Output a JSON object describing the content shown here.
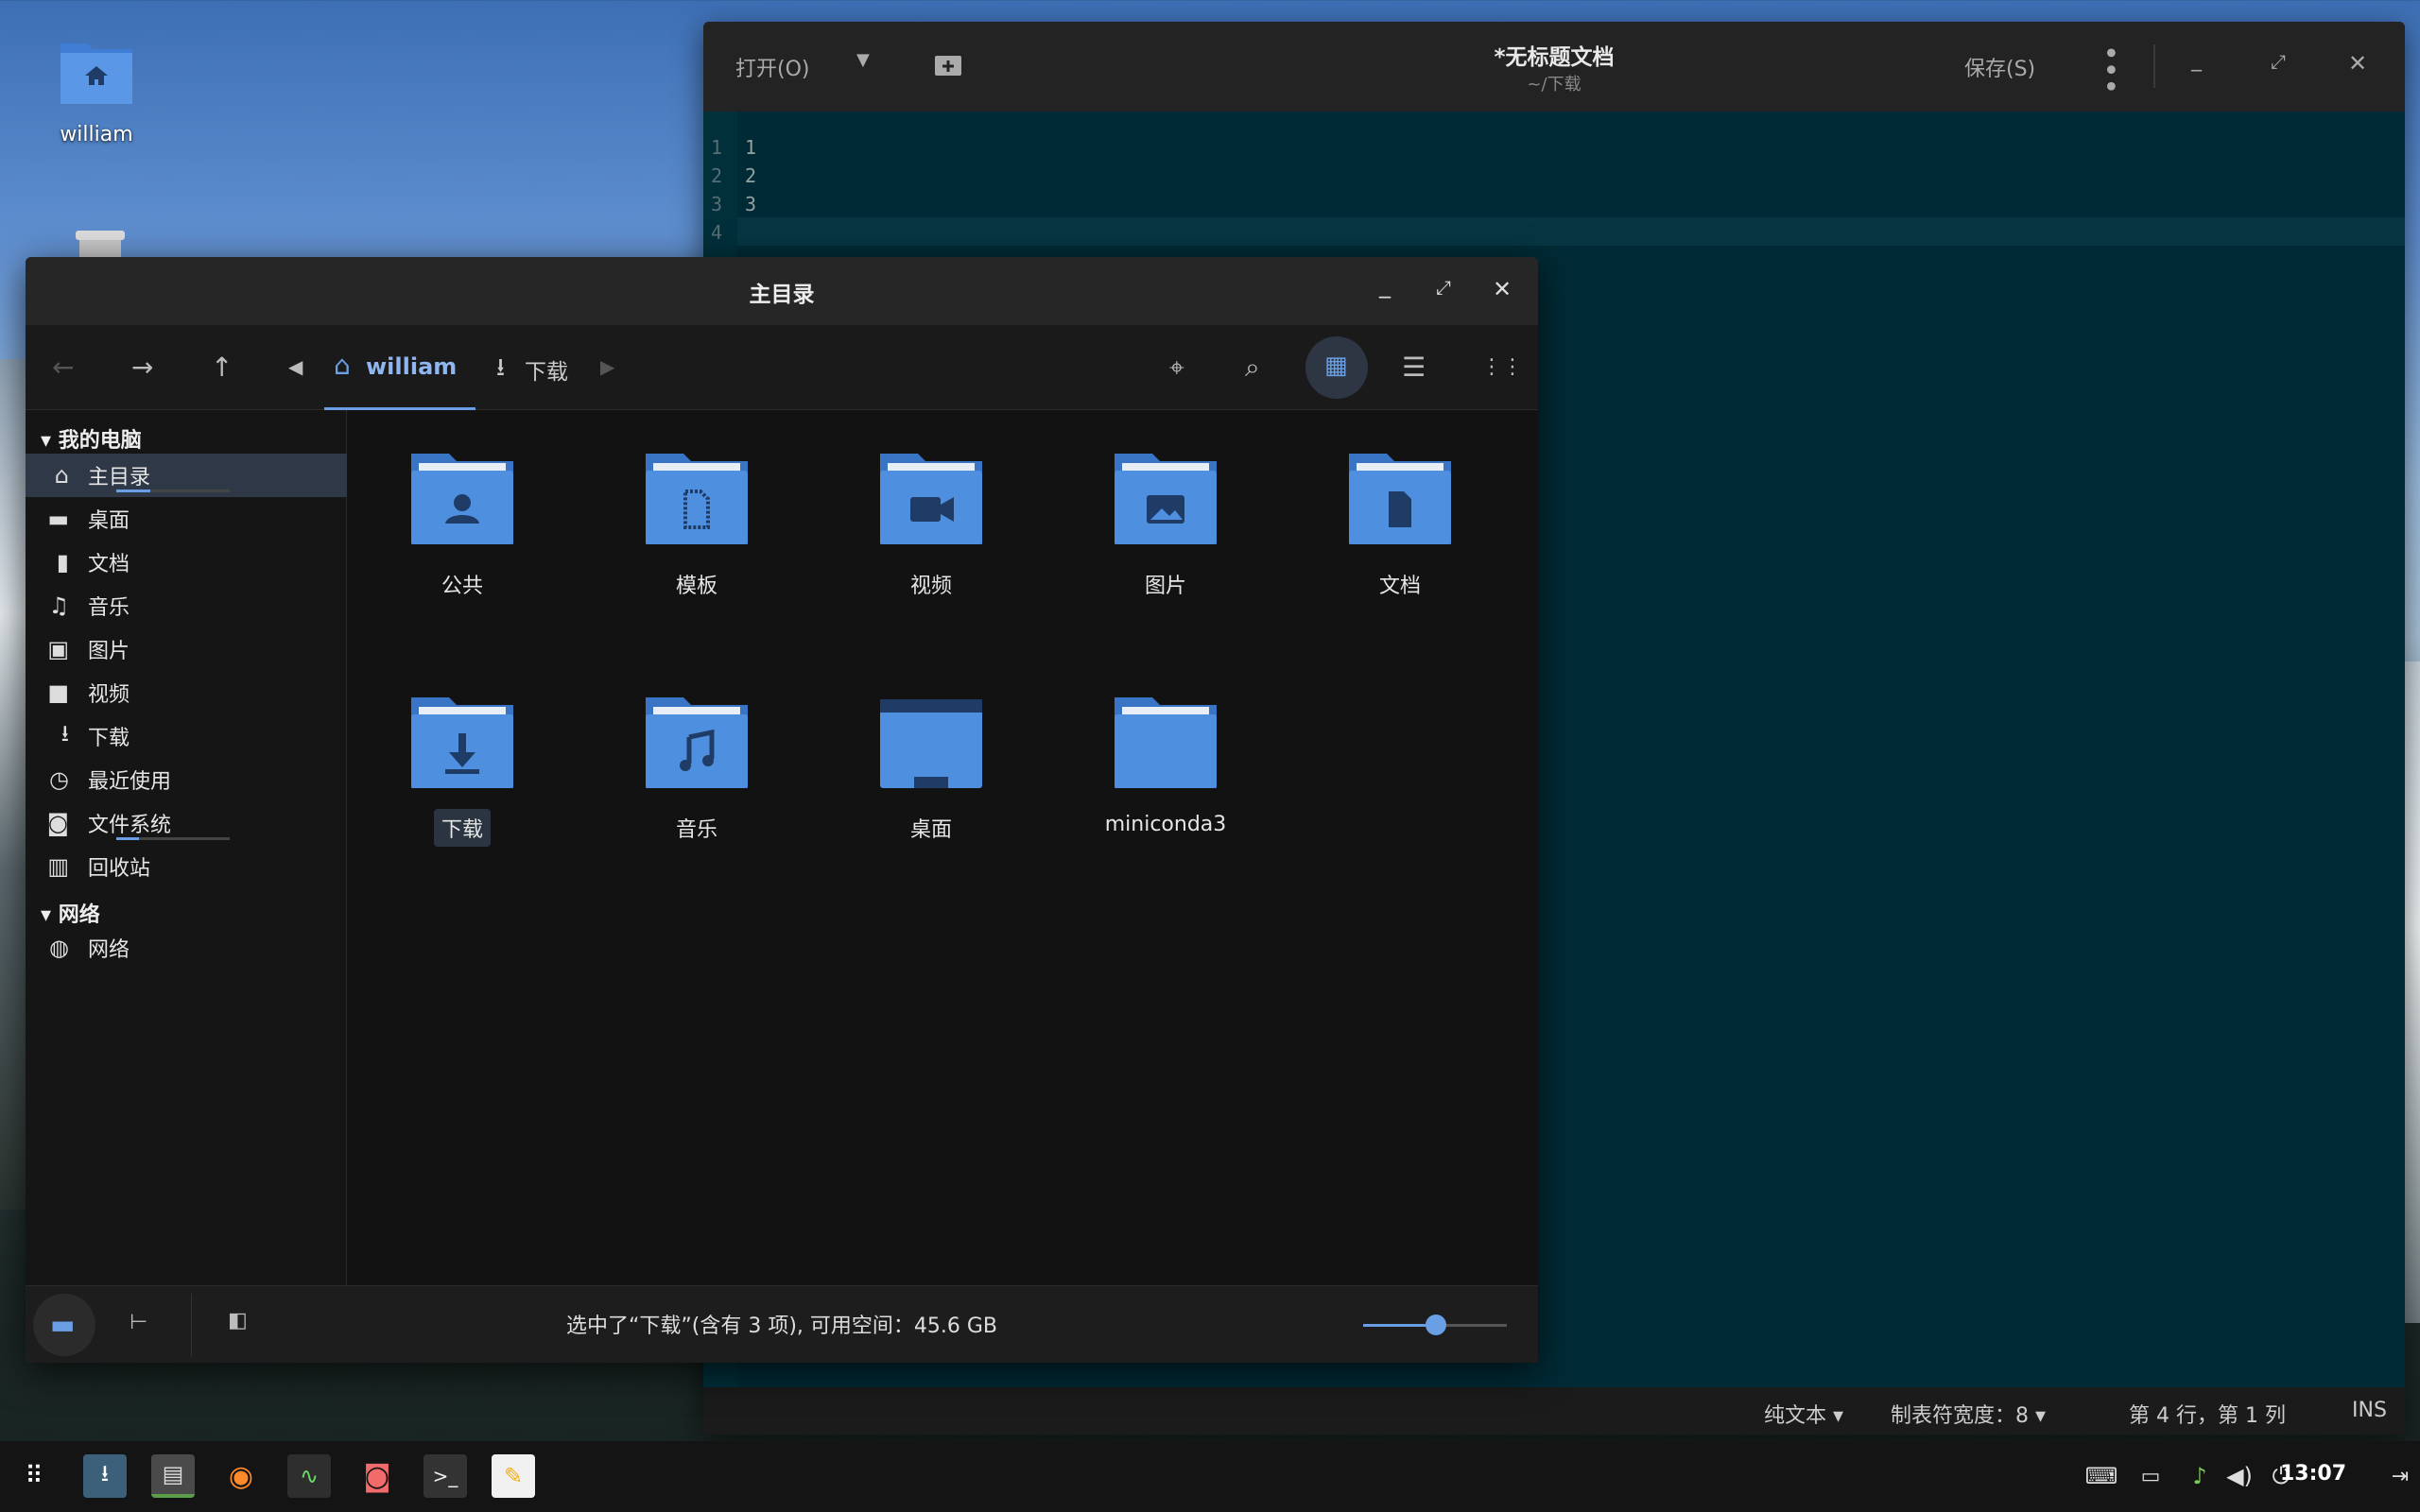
{
  "desktop": {
    "icons": [
      {
        "label": "william",
        "icon": "home-folder-icon"
      },
      {
        "label": "",
        "icon": "trash-icon"
      }
    ]
  },
  "editor": {
    "open_label": "打开(O)",
    "title": "*无标题文档",
    "subtitle": "~/下载",
    "save_label": "保存(S)",
    "lines": [
      "1",
      "2",
      "3",
      ""
    ],
    "line_numbers": [
      "1",
      "2",
      "3",
      "4"
    ],
    "status": {
      "syntax": "纯文本",
      "tab_width": "制表符宽度：8",
      "position": "第 4 行，第 1 列",
      "mode": "INS"
    }
  },
  "filemanager": {
    "title": "主目录",
    "breadcrumb": [
      {
        "label": "william",
        "icon": "home-icon"
      },
      {
        "label": "下载",
        "icon": "download-icon"
      }
    ],
    "sidebar": {
      "sections": [
        {
          "header": "我的电脑",
          "items": [
            {
              "label": "主目录",
              "icon": "home-icon",
              "selected": true
            },
            {
              "label": "桌面",
              "icon": "desktop-icon"
            },
            {
              "label": "文档",
              "icon": "document-icon"
            },
            {
              "label": "音乐",
              "icon": "music-icon"
            },
            {
              "label": "图片",
              "icon": "image-icon"
            },
            {
              "label": "视频",
              "icon": "video-icon"
            },
            {
              "label": "下载",
              "icon": "download-icon"
            },
            {
              "label": "最近使用",
              "icon": "clock-icon"
            },
            {
              "label": "文件系统",
              "icon": "drive-icon"
            },
            {
              "label": "回收站",
              "icon": "trash-icon"
            }
          ]
        },
        {
          "header": "网络",
          "items": [
            {
              "label": "网络",
              "icon": "globe-icon"
            }
          ]
        }
      ]
    },
    "files": [
      {
        "label": "公共",
        "icon": "user-icon"
      },
      {
        "label": "模板",
        "icon": "template-icon"
      },
      {
        "label": "视频",
        "icon": "video-icon"
      },
      {
        "label": "图片",
        "icon": "image-icon"
      },
      {
        "label": "文档",
        "icon": "document-icon"
      },
      {
        "label": "下载",
        "icon": "download-icon",
        "selected": true
      },
      {
        "label": "音乐",
        "icon": "music-icon"
      },
      {
        "label": "桌面",
        "icon": "desktop-icon"
      },
      {
        "label": "miniconda3",
        "icon": "folder-icon"
      }
    ],
    "status": "选中了“下载”(含有 3 项), 可用空间：45.6 GB",
    "zoom_level": 0.5
  },
  "taskbar": {
    "clock": "13:07",
    "accent": "#5a9e4a"
  },
  "colors": {
    "folder": "#4f8fe0",
    "folder_dark": "#2f5f9e",
    "accent": "#6a9fe5"
  }
}
